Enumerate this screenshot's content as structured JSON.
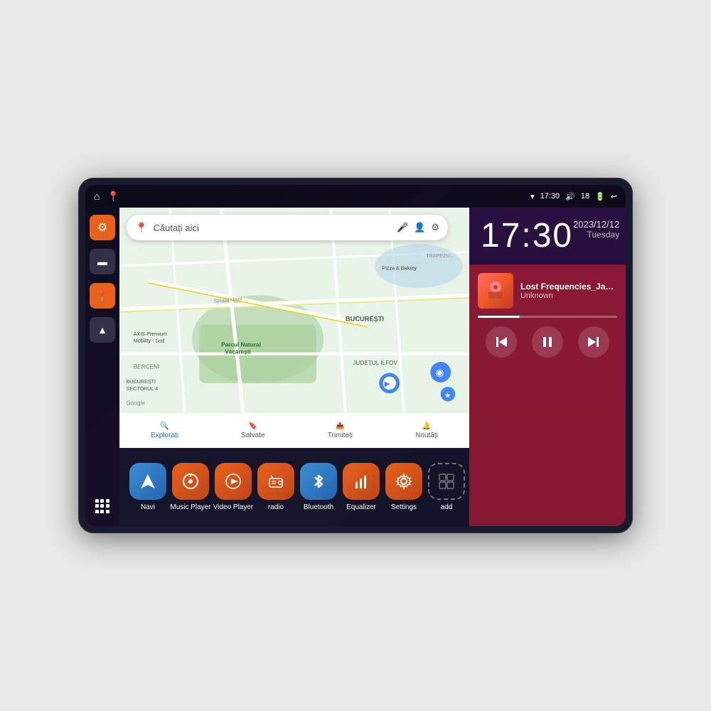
{
  "device": {
    "statusBar": {
      "leftIcons": [
        "⌂",
        "📍"
      ],
      "time": "17:30",
      "rightIcons": [
        "wifi",
        "volume",
        "18",
        "battery",
        "back"
      ]
    },
    "clock": {
      "time": "17:30",
      "date": "2023/12/12",
      "day": "Tuesday"
    },
    "music": {
      "title": "Lost Frequencies_Janie...",
      "artist": "Unknown",
      "progress": 30
    },
    "controls": {
      "prev": "⏮",
      "pause": "⏸",
      "next": "⏭"
    },
    "map": {
      "searchPlaceholder": "Căutați aici",
      "tabs": [
        {
          "label": "Explorați",
          "icon": "🔍",
          "active": true
        },
        {
          "label": "Salvate",
          "icon": "🔖",
          "active": false
        },
        {
          "label": "Trimiteți",
          "icon": "📤",
          "active": false
        },
        {
          "label": "Noutăți",
          "icon": "🔔",
          "active": false
        }
      ],
      "places": [
        "AXIS Premium Mobility - Sud",
        "Pizza & Bakery",
        "Parcul Natural Văcărești",
        "BUCUREȘTI",
        "JUDEȚUL ILFOV",
        "BUCUREȘTI SECTORUL 4",
        "BERCENI"
      ]
    },
    "sidebar": {
      "buttons": [
        {
          "id": "settings",
          "icon": "⚙",
          "color": "orange"
        },
        {
          "id": "files",
          "icon": "📁",
          "color": "dark"
        },
        {
          "id": "maps",
          "icon": "📍",
          "color": "orange"
        },
        {
          "id": "nav",
          "icon": "▲",
          "color": "dark"
        }
      ]
    },
    "apps": [
      {
        "id": "navi",
        "label": "Navi",
        "icon": "▲",
        "bg": "#3a8fd4"
      },
      {
        "id": "music-player",
        "label": "Music Player",
        "icon": "♪",
        "bg": "#e8621a"
      },
      {
        "id": "video-player",
        "label": "Video Player",
        "icon": "▶",
        "bg": "#e8621a"
      },
      {
        "id": "radio",
        "label": "radio",
        "icon": "📻",
        "bg": "#e8621a"
      },
      {
        "id": "bluetooth",
        "label": "Bluetooth",
        "icon": "⚡",
        "bg": "#3a8fd4"
      },
      {
        "id": "equalizer",
        "label": "Equalizer",
        "icon": "≡",
        "bg": "#e8621a"
      },
      {
        "id": "settings",
        "label": "Settings",
        "icon": "⚙",
        "bg": "#e8621a"
      },
      {
        "id": "add",
        "label": "add",
        "icon": "+",
        "bg": "dashed"
      }
    ]
  }
}
